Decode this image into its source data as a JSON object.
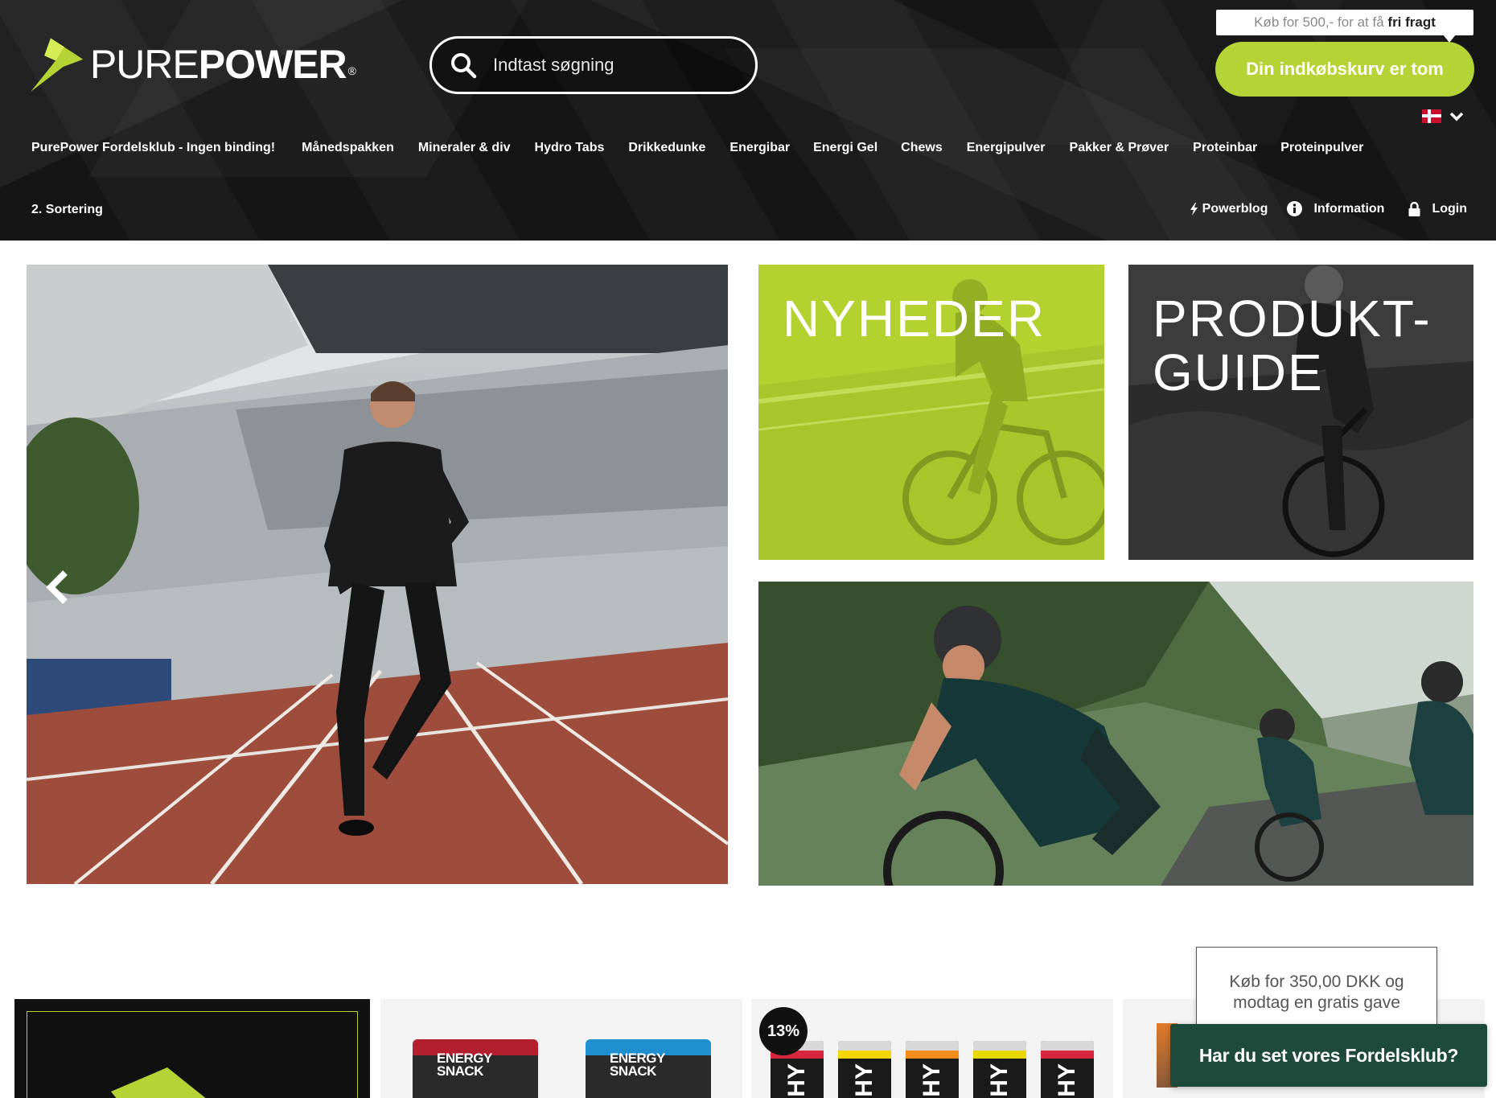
{
  "brand": {
    "name_part1": "PURE",
    "name_part2": "POWER",
    "registered": "®",
    "accent_color": "#b5d334"
  },
  "search": {
    "placeholder": "Indtast søgning"
  },
  "promo": {
    "free_shipping_prefix": "Køb for 500,- for at få ",
    "free_shipping_bold": "fri fragt"
  },
  "cart": {
    "label": "Din indkøbskurv er tom"
  },
  "language": {
    "flag": "danish-flag-icon"
  },
  "nav": {
    "items": [
      {
        "label": "PurePower Fordelsklub - Ingen binding!"
      },
      {
        "label": "Månedspakken"
      },
      {
        "label": "Mineraler & div"
      },
      {
        "label": "Hydro Tabs"
      },
      {
        "label": "Drikkedunke"
      },
      {
        "label": "Energibar"
      },
      {
        "label": "Energi Gel"
      },
      {
        "label": "Chews"
      },
      {
        "label": "Energipulver"
      },
      {
        "label": "Pakker & Prøver"
      },
      {
        "label": "Proteinbar"
      },
      {
        "label": "Proteinpulver"
      }
    ],
    "secondary_left": "2. Sortering",
    "secondary_right": [
      {
        "label": "Powerblog",
        "icon": "lightning-icon"
      },
      {
        "label": "Information",
        "icon": "info-icon"
      },
      {
        "label": "Login",
        "icon": "lock-icon"
      }
    ]
  },
  "tiles": {
    "news_title": "NYHEDER",
    "guide_title_line1": "PRODUKT-",
    "guide_title_line2": "GUIDE",
    "news_color": "#b3d12f"
  },
  "products": {
    "snack1_label_line1": "ENERGY",
    "snack1_label_line2": "SNACK",
    "snack2_label_line1": "ENERGY",
    "snack2_label_line2": "SNACK",
    "discount": "13%",
    "tube_label": "HY"
  },
  "popup": {
    "gift_line1": "Køb for 350,00 DKK og",
    "gift_line2": "modtag en gratis gave"
  },
  "club_banner": {
    "label": "Har du set vores Fordelsklub?",
    "color": "#1e4a3c"
  }
}
